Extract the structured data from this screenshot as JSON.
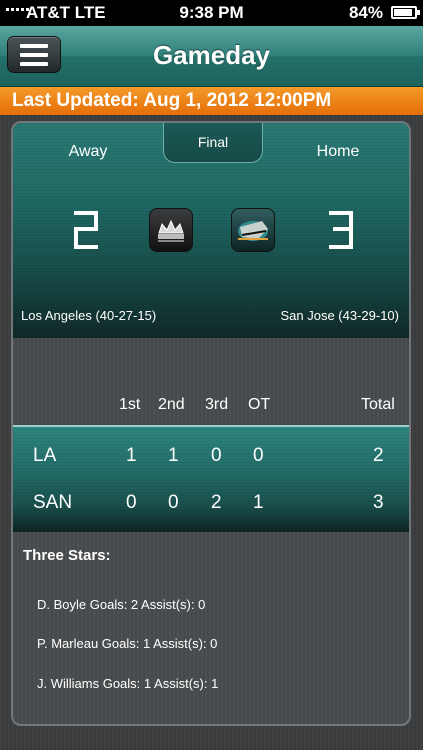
{
  "status_bar": {
    "carrier": "AT&T  LTE",
    "time": "9:38 PM",
    "battery": "84%"
  },
  "nav": {
    "title": "Gameday"
  },
  "updated": {
    "text": "Last Updated: Aug 1, 2012 12:00PM"
  },
  "game": {
    "status": "Final",
    "away_label": "Away",
    "home_label": "Home",
    "away_score": 2,
    "home_score": 3,
    "away_team": "Los Angeles (40-27-15)",
    "home_team": "San Jose  (43-29-10)"
  },
  "periods": {
    "headers": [
      "1st",
      "2nd",
      "3rd",
      "OT",
      "Total"
    ],
    "rows": [
      {
        "team": "LA",
        "p1": "1",
        "p2": "1",
        "p3": "0",
        "ot": "0",
        "total": "2"
      },
      {
        "team": "SAN",
        "p1": "0",
        "p2": "0",
        "p3": "2",
        "ot": "1",
        "total": "3"
      }
    ]
  },
  "stars": {
    "title": "Three Stars:",
    "items": [
      "D. Boyle Goals: 2 Assist(s): 0",
      "P. Marleau Goals: 1 Assist(s): 0",
      "J. Williams Goals: 1 Assist(s): 1"
    ]
  },
  "colors": {
    "nav_teal": "#2f8079",
    "updated_orange": "#e46e08",
    "panel_teal": "#1f6662"
  }
}
